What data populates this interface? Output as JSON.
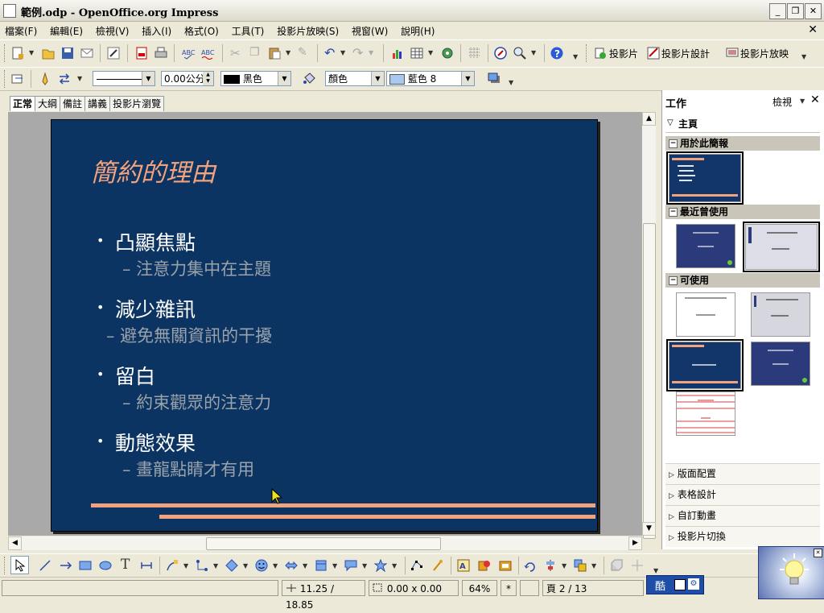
{
  "window": {
    "title": "範例.odp - OpenOffice.org Impress"
  },
  "menu": {
    "items": [
      "檔案(F)",
      "編輯(E)",
      "檢視(V)",
      "插入(I)",
      "格式(O)",
      "工具(T)",
      "投影片放映(S)",
      "視窗(W)",
      "說明(H)"
    ]
  },
  "toolbar": {
    "slide_label": "投影片",
    "slide_design_label": "投影片設計",
    "slideshow_label": "投影片放映"
  },
  "line_toolbar": {
    "line_width": "0.00公分",
    "line_color": "黑色",
    "area_style": "顏色",
    "area_color": "藍色 8"
  },
  "view_tabs": [
    "正常",
    "大綱",
    "備註",
    "講義",
    "投影片瀏覽"
  ],
  "slide": {
    "title": "簡約的理由",
    "bullets": [
      {
        "text": "凸顯焦點",
        "sub": "– 注意力集中在主題"
      },
      {
        "text": "減少雜訊",
        "sub": "– 避免無關資訊的干擾"
      },
      {
        "text": "留白",
        "sub": "– 約束觀眾的注意力"
      },
      {
        "text": "動態效果",
        "sub": "– 畫龍點睛才有用"
      }
    ]
  },
  "task_pane": {
    "title": "工作",
    "view_label": "檢視",
    "home_label": "主頁",
    "sections": [
      "用於此簡報",
      "最近曾使用",
      "可使用"
    ],
    "accordion": [
      "版面配置",
      "表格設計",
      "自訂動畫",
      "投影片切換"
    ]
  },
  "status": {
    "position": "11.25 / 18.85",
    "size": "0.00 x 0.00",
    "zoom": "64%",
    "modified": "*",
    "page": "頁 2 / 13"
  },
  "ime": {
    "mode": "酷"
  },
  "colors": {
    "slide_bg": "#0c3462",
    "title": "#f2a37d",
    "accent": "#f2a37d"
  }
}
